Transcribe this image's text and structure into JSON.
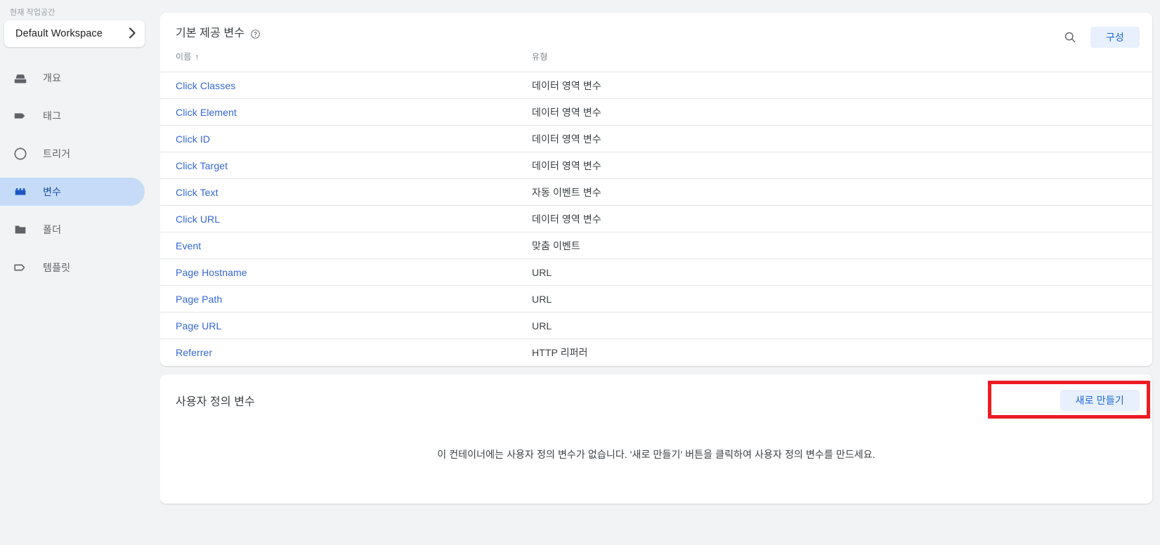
{
  "sidebar": {
    "workspace_label": "현재 작업공간",
    "workspace_name": "Default Workspace",
    "chevron": "›",
    "items": [
      {
        "label": "개요",
        "icon": "overview-icon",
        "active": false
      },
      {
        "label": "태그",
        "icon": "tag-icon",
        "active": false
      },
      {
        "label": "트리거",
        "icon": "trigger-icon",
        "active": false
      },
      {
        "label": "변수",
        "icon": "variables-icon",
        "active": true
      },
      {
        "label": "폴더",
        "icon": "folder-icon",
        "active": false
      },
      {
        "label": "템플릿",
        "icon": "template-icon",
        "active": false
      }
    ]
  },
  "builtin": {
    "title": "기본 제공 변수",
    "help_icon": "help-circle-icon",
    "search_icon": "search-icon",
    "configure_label": "구성",
    "columns": {
      "name": "이름",
      "sort_arrow": "↑",
      "type": "유형"
    },
    "rows": [
      {
        "name": "Click Classes",
        "type": "데이터 영역 변수"
      },
      {
        "name": "Click Element",
        "type": "데이터 영역 변수"
      },
      {
        "name": "Click ID",
        "type": "데이터 영역 변수"
      },
      {
        "name": "Click Target",
        "type": "데이터 영역 변수"
      },
      {
        "name": "Click Text",
        "type": "자동 이벤트 변수"
      },
      {
        "name": "Click URL",
        "type": "데이터 영역 변수"
      },
      {
        "name": "Event",
        "type": "맞춤 이벤트"
      },
      {
        "name": "Page Hostname",
        "type": "URL"
      },
      {
        "name": "Page Path",
        "type": "URL"
      },
      {
        "name": "Page URL",
        "type": "URL"
      },
      {
        "name": "Referrer",
        "type": "HTTP 리퍼러"
      }
    ]
  },
  "user_defined": {
    "title": "사용자 정의 변수",
    "new_label": "새로 만들기",
    "empty_message": "이 컨테이너에는 사용자 정의 변수가 없습니다. '새로 만들기' 버튼을 클릭하여 사용자 정의 변수를 만드세요."
  },
  "annotation": {
    "highlight_color": "#ed1c24",
    "target": "새로 만들기"
  },
  "colors": {
    "accent": "#1967d2",
    "link": "#3367d6",
    "active_nav_bg": "#c5dbf7",
    "page_bg": "#f1f3f4",
    "card_bg": "#ffffff"
  }
}
